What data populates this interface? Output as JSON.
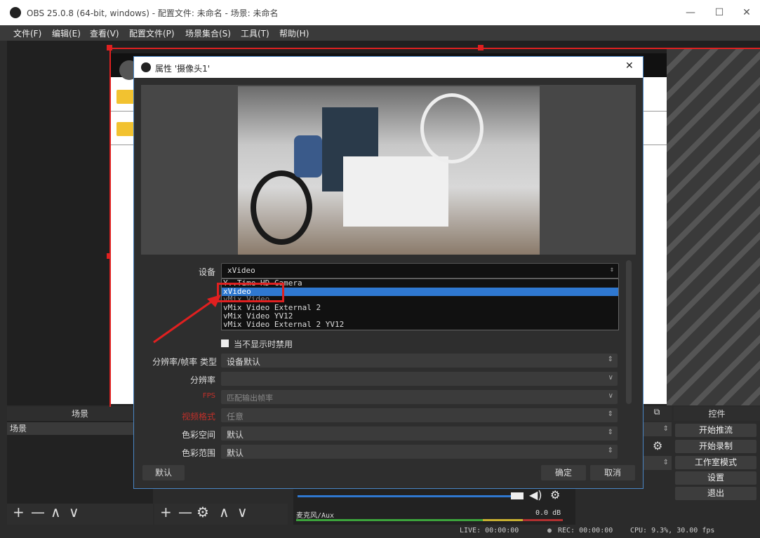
{
  "window": {
    "title": "OBS 25.0.8 (64-bit, windows) - 配置文件: 未命名 - 场景: 未命名",
    "minimize": "—",
    "maximize": "☐",
    "close": "✕"
  },
  "menu": [
    "文件(F)",
    "编辑(E)",
    "查看(V)",
    "配置文件(P)",
    "场景集合(S)",
    "工具(T)",
    "帮助(H)"
  ],
  "scenes": {
    "header": "场景",
    "items": [
      "场景"
    ]
  },
  "controls": {
    "header": "控件",
    "buttons": [
      "开始推流",
      "开始录制",
      "工作室模式",
      "设置",
      "退出"
    ]
  },
  "mixer": {
    "channel": "麦克风/Aux",
    "level": "0.0 dB"
  },
  "status": {
    "live": "LIVE: 00:00:00",
    "rec": "REC: 00:00:00",
    "cpu": "CPU: 9.3%, 30.00 fps"
  },
  "dialog": {
    "title": "属性 '摄像头1'",
    "close": "✕",
    "device_label": "设备",
    "device_value": "xVideo",
    "device_options": [
      "Y..Time HD Camera",
      "xVideo",
      "vMix Video",
      "vMix Video External 2",
      "vMix Video YV12",
      "vMix Video External 2 YV12"
    ],
    "deactivate_label": "当不显示时禁用",
    "res_type_label": "分辨率/帧率 类型",
    "res_type_value": "设备默认",
    "resolution_label": "分辨率",
    "resolution_value": "",
    "fps_label": "FPS",
    "fps_value": "匹配输出帧率",
    "video_format_label": "视频格式",
    "video_format_value": "任意",
    "color_space_label": "色彩空间",
    "color_space_value": "默认",
    "color_range_label": "色彩范围",
    "color_range_value": "默认",
    "defaults_button": "默认",
    "ok_button": "确定",
    "cancel_button": "取消"
  },
  "colors": {
    "accent": "#2f78d0",
    "highlight_red": "#e02020"
  }
}
